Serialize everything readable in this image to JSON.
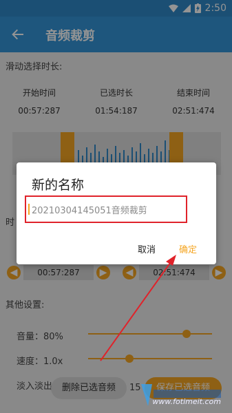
{
  "status": {
    "time": "2:50"
  },
  "app": {
    "title": "音频裁剪"
  },
  "trim": {
    "header": "滑动选择时长:",
    "start_label": "开始时间",
    "selected_label": "已选时长",
    "end_label": "结束时间",
    "start_value": "00:57:287",
    "selected_value": "01:54:187",
    "end_value": "02:51:474"
  },
  "row": {
    "label": "时",
    "start_box": "00:57:287",
    "end_box": "02:51:474"
  },
  "other": {
    "header": "其他设置:",
    "volume_label": "音量：80%",
    "volume_value": 0.8,
    "speed_label": "速度：1.0x",
    "speed_value": 0.4,
    "fade_label": "淡入淡出"
  },
  "bottom": {
    "delete_label": "删除已选音频",
    "mid_label": "15",
    "save_label": "保存已选音频"
  },
  "dialog": {
    "title": "新的名称",
    "input_value": "20210304145051音频裁剪",
    "cancel_label": "取消",
    "confirm_label": "确定"
  },
  "watermark": {
    "text": "www.fotimeit.com"
  },
  "colors": {
    "primary": "#3494d8",
    "accent": "#f5a623",
    "highlight": "#e0222a"
  }
}
